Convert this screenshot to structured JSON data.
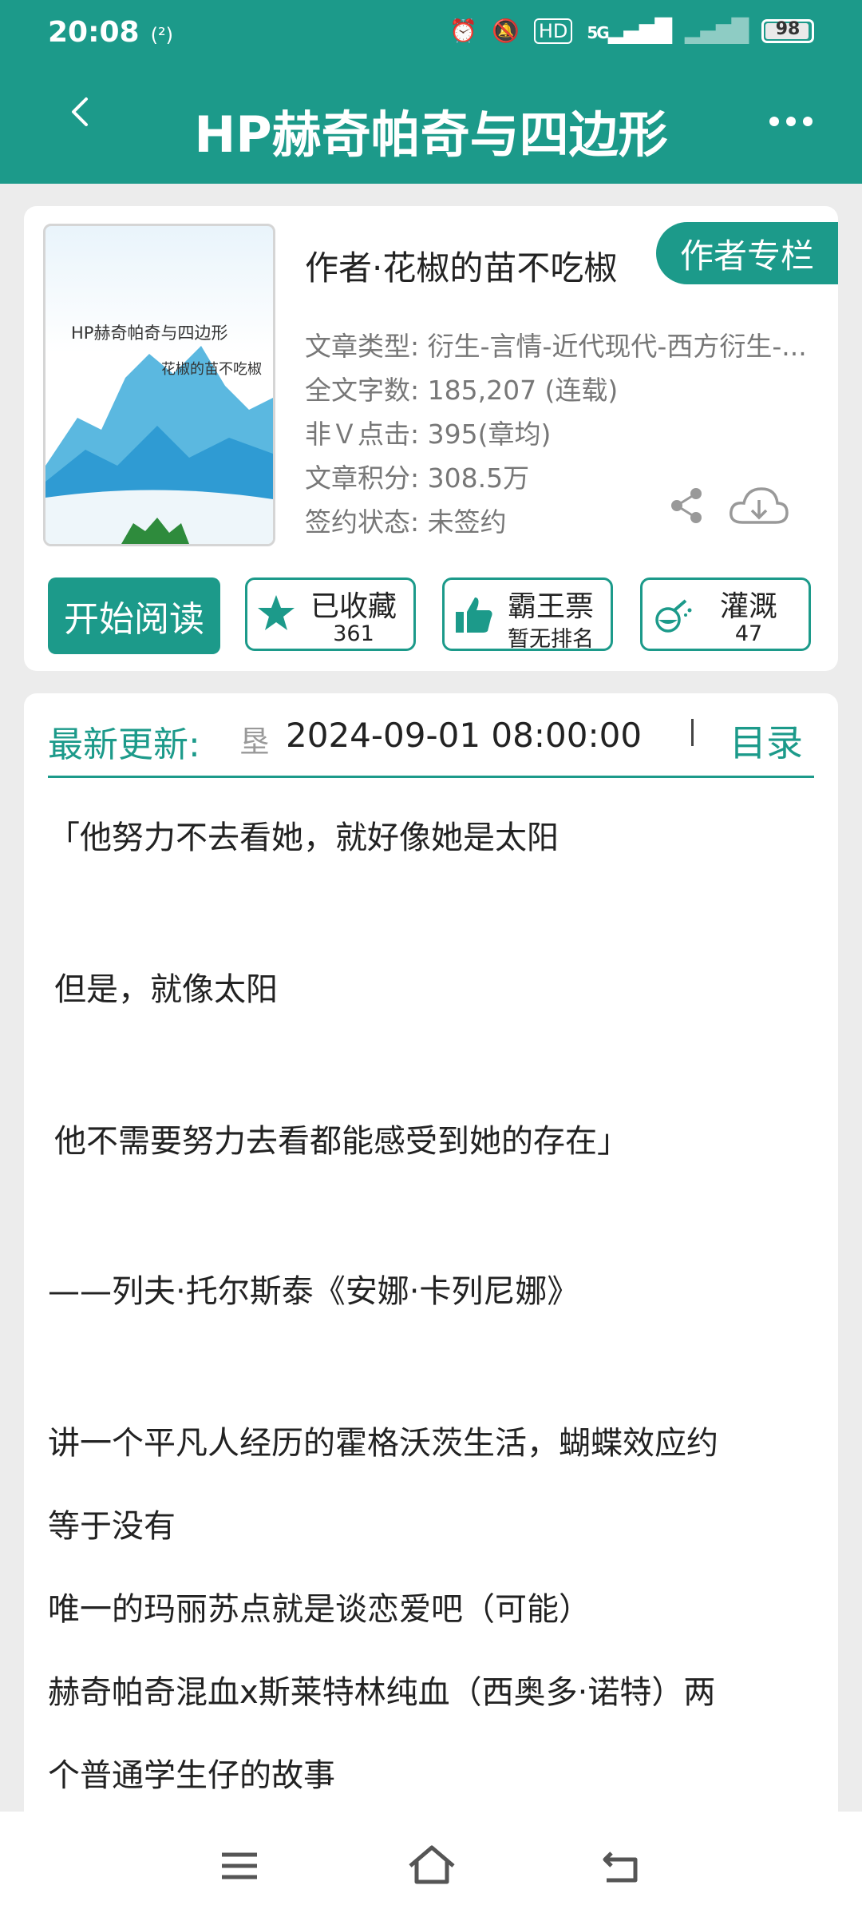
{
  "status": {
    "time": "20:08",
    "wifi": "(²)",
    "net": "5G",
    "battery": "98"
  },
  "header": {
    "title": "HP赫奇帕奇与四边形"
  },
  "book": {
    "cover_title": "HP赫奇帕奇与四边形",
    "cover_author": "花椒的苗不吃椒",
    "author_line": "作者·花椒的苗不吃椒",
    "author_column_button": "作者专栏",
    "meta": [
      "文章类型: 衍生-言情-近代现代-西方衍生-...",
      "全文字数: 185,207 (连载)",
      "非Ｖ点击: 395(章均)",
      "文章积分: 308.5万",
      "签约状态: 未签约"
    ],
    "read_button": "开始阅读",
    "actions": [
      {
        "label": "已收藏",
        "count": "361",
        "icon": "star-icon"
      },
      {
        "label": "霸王票",
        "count": "暂无排名",
        "icon": "thumbs-up-icon"
      },
      {
        "label": "灌溉",
        "count": "47",
        "icon": "watering-icon"
      }
    ]
  },
  "update": {
    "label": "最新更新:",
    "glyph": "垦",
    "date": "2024-09-01 08:00:00",
    "toc_label": "目录"
  },
  "content": [
    "「他努力不去看她，就好像她是太阳",
    "但是，就像太阳",
    "他不需要努力去看都能感受到她的存在」",
    "——列夫·托尔斯泰《安娜·卡列尼娜》",
    "讲一个平凡人经历的霍格沃茨生活，蝴蝶效应约",
    "等于没有",
    "唯一的玛丽苏点就是谈恋爱吧（可能）",
    "赫奇帕奇混血x斯莱特林纯血（西奥多·诺特）两",
    "个普通学生仔的故事"
  ],
  "colors": {
    "brand": "#1c9a8a",
    "background": "#ececec"
  }
}
